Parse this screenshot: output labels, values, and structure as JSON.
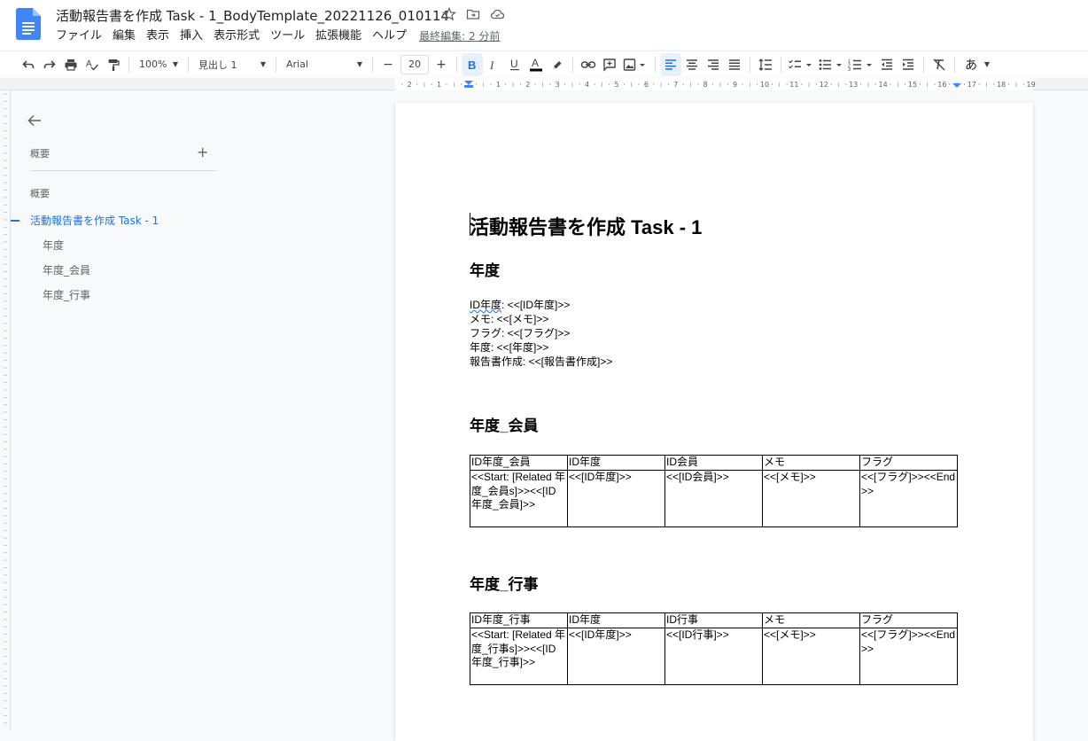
{
  "app": {
    "title": "活動報告書を作成 Task - 1_BodyTemplate_20221126_010114",
    "brand_color": "#4285f4"
  },
  "menu": {
    "items": [
      "ファイル",
      "編集",
      "表示",
      "挿入",
      "表示形式",
      "ツール",
      "拡張機能",
      "ヘルプ"
    ],
    "last_edit": "最終編集: 2 分前"
  },
  "toolbar": {
    "zoom": "100%",
    "style": "見出し 1",
    "font": "Arial",
    "font_size": "20",
    "minus": "−",
    "plus": "+",
    "input_method": "あ"
  },
  "ruler": {
    "labels": [
      "2",
      "1",
      "1",
      "2",
      "3",
      "4",
      "5",
      "6",
      "7",
      "8",
      "9",
      "10",
      "11",
      "12",
      "13",
      "14",
      "15",
      "16",
      "17",
      "18",
      "19"
    ]
  },
  "outline": {
    "label": "概要",
    "add": "+",
    "summary_label": "概要",
    "items": [
      {
        "text": "活動報告書を作成 Task - 1",
        "level": 1
      },
      {
        "text": "年度",
        "level": 2
      },
      {
        "text": "年度_会員",
        "level": 2
      },
      {
        "text": "年度_行事",
        "level": 2
      }
    ]
  },
  "document": {
    "title": "活動報告書を作成 Task - 1",
    "section1": {
      "heading": "年度",
      "lines": [
        {
          "label": "ID年度",
          "rest": ": <<[ID年度]>>"
        },
        {
          "label": "",
          "rest": "メモ: <<[メモ]>>"
        },
        {
          "label": "",
          "rest": "フラグ: <<[フラグ]>>"
        },
        {
          "label": "",
          "rest": "年度: <<[年度]>>"
        },
        {
          "label": "",
          "rest": "報告書作成: <<[報告書作成]>>"
        }
      ]
    },
    "section2": {
      "heading": "年度_会員",
      "headers": [
        "ID年度_会員",
        "ID年度",
        "ID会員",
        "メモ",
        "フラグ"
      ],
      "cells": [
        "<<Start: [Related 年度_会員s]>><<[ID年度_会員]>>",
        "<<[ID年度]>>",
        "<<[ID会員]>>",
        "<<[メモ]>>",
        "<<[フラグ]>><<End>>"
      ]
    },
    "section3": {
      "heading": "年度_行事",
      "headers": [
        "ID年度_行事",
        "ID年度",
        "ID行事",
        "メモ",
        "フラグ"
      ],
      "cells": [
        "<<Start: [Related 年度_行事s]>><<[ID年度_行事]>>",
        "<<[ID年度]>>",
        "<<[ID行事]>>",
        "<<[メモ]>>",
        "<<[フラグ]>><<End>>"
      ]
    }
  }
}
